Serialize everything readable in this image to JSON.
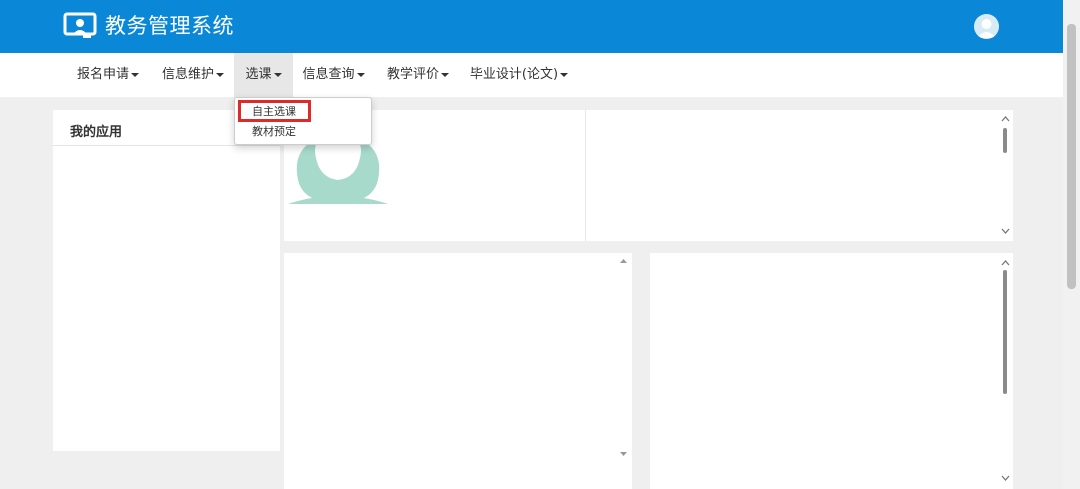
{
  "header": {
    "title": "教务管理系统",
    "bg_color": "#0a88d7"
  },
  "nav": {
    "items": [
      {
        "label": "报名申请",
        "has_caret": true
      },
      {
        "label": "信息维护",
        "has_caret": true
      },
      {
        "label": "选课",
        "has_caret": true,
        "active": true
      },
      {
        "label": "信息查询",
        "has_caret": true
      },
      {
        "label": "教学评价",
        "has_caret": true
      },
      {
        "label": "毕业设计(论文)",
        "has_caret": true
      }
    ]
  },
  "dropdown": {
    "items": [
      {
        "label": "自主选课",
        "highlighted": true
      },
      {
        "label": "教材预定"
      }
    ],
    "highlight_color": "#e02a2a"
  },
  "sidebar": {
    "title": "我的应用"
  },
  "icons": {
    "logo": "monitor-person-icon",
    "avatar": "user-avatar-icon",
    "profile_placeholder": "user-silhouette-icon"
  }
}
